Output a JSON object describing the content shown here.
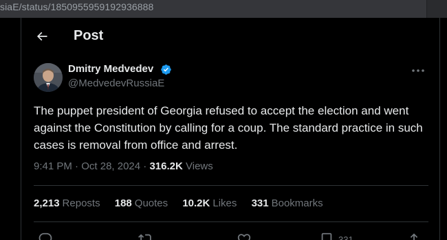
{
  "browser": {
    "url": "siaE/status/1850955959192936888"
  },
  "header": {
    "title": "Post"
  },
  "post": {
    "author_name": "Dmitry Medvedev",
    "handle": "@MedvedevRussiaE",
    "text": "The puppet president of Georgia refused to accept the election and went against the Constitution by calling for a coup. The standard practice in such cases is removal from office and arrest.",
    "time": "9:41 PM",
    "date": "Oct 28, 2024",
    "separator": "·",
    "views_count": "316.2K",
    "views_label": "Views",
    "stats": {
      "reposts": {
        "count": "2,213",
        "label": "Reposts"
      },
      "quotes": {
        "count": "188",
        "label": "Quotes"
      },
      "likes": {
        "count": "10.2K",
        "label": "Likes"
      },
      "bookmarks": {
        "count": "331",
        "label": "Bookmarks"
      }
    },
    "actions": {
      "bookmark_count": "331"
    }
  },
  "icons": {
    "back": "arrow-left-icon",
    "verified": "verified-badge-icon",
    "more": "more-horizontal-icon",
    "reply": "reply-icon",
    "repost": "repost-icon",
    "like": "like-icon",
    "bookmark": "bookmark-icon",
    "share": "share-icon"
  },
  "colors": {
    "background": "#000000",
    "text_primary": "#e7e9ea",
    "text_secondary": "#71767b",
    "border": "#2f3336",
    "verified": "#1d9bf0",
    "urlbar": "#35363a"
  }
}
